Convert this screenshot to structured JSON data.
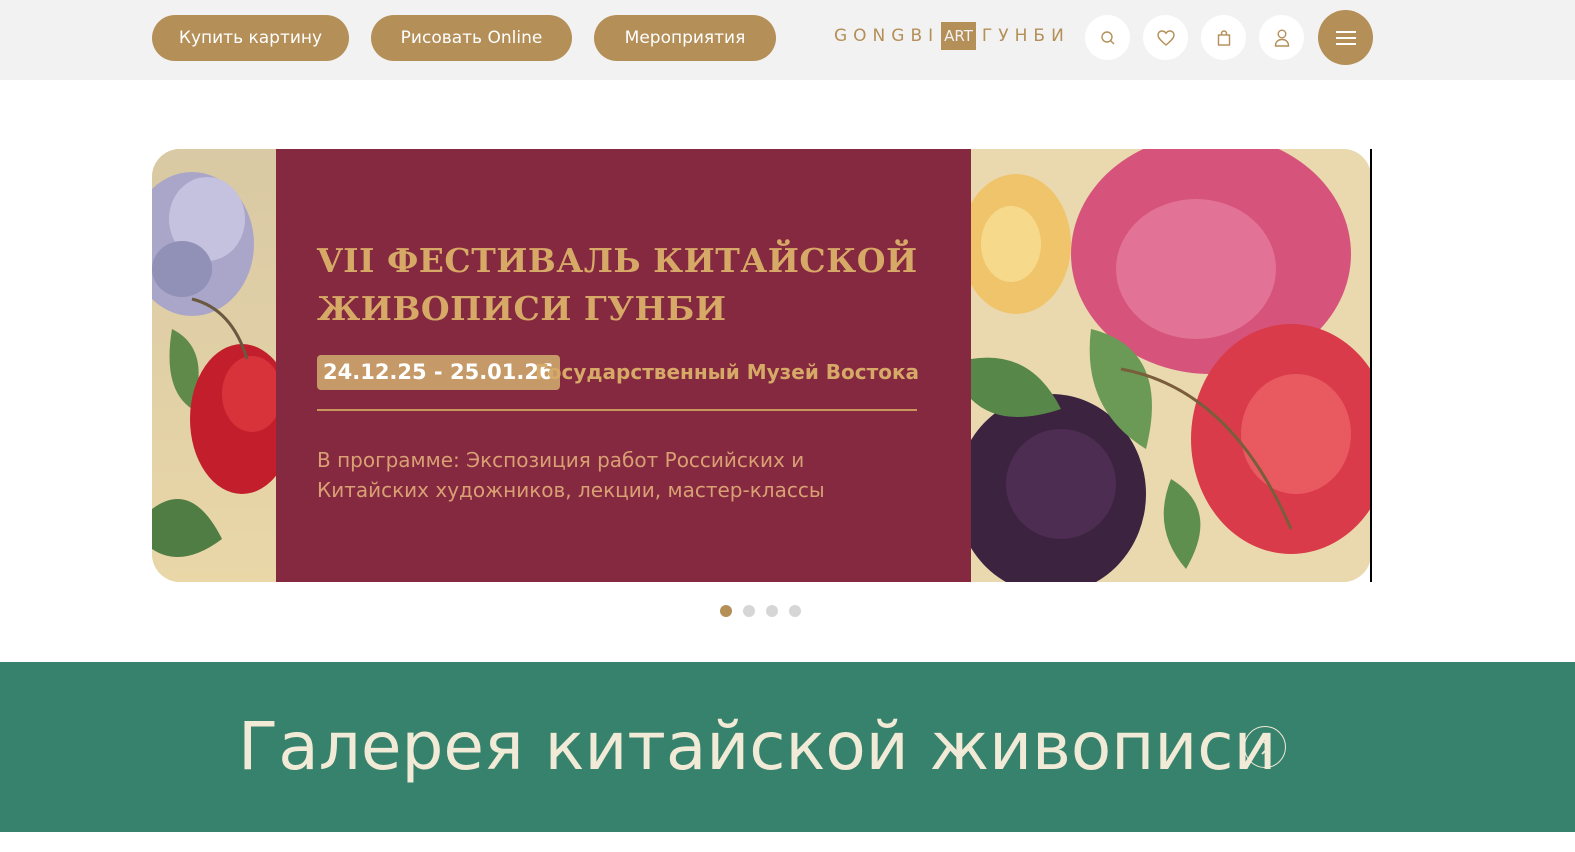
{
  "header": {
    "nav": [
      {
        "label": "Купить картину"
      },
      {
        "label": "Рисовать Online"
      },
      {
        "label": "Мероприятия"
      }
    ],
    "logo": {
      "left": "GONGBI",
      "art": "ART",
      "right": "ГУНБИ"
    },
    "icons": [
      "search-icon",
      "heart-icon",
      "bag-icon",
      "user-icon",
      "menu-icon"
    ],
    "accent_color": "#b48f58"
  },
  "banner": {
    "title": "VII ФЕСТИВАЛЬ КИТАЙСКОЙ ЖИВОПИСИ ГУНБИ",
    "dates": "24.12.25 - 25.01.26",
    "venue": "Государственный Музей Востока",
    "program": "В программе: Экспозиция работ Российских и Китайских художников, лекции, мастер-классы",
    "panel_color": "#84293f",
    "slides_total": 4,
    "active_slide": 1
  },
  "gallery": {
    "title": "Галерея китайской живописи",
    "bg_color": "#37826d"
  }
}
